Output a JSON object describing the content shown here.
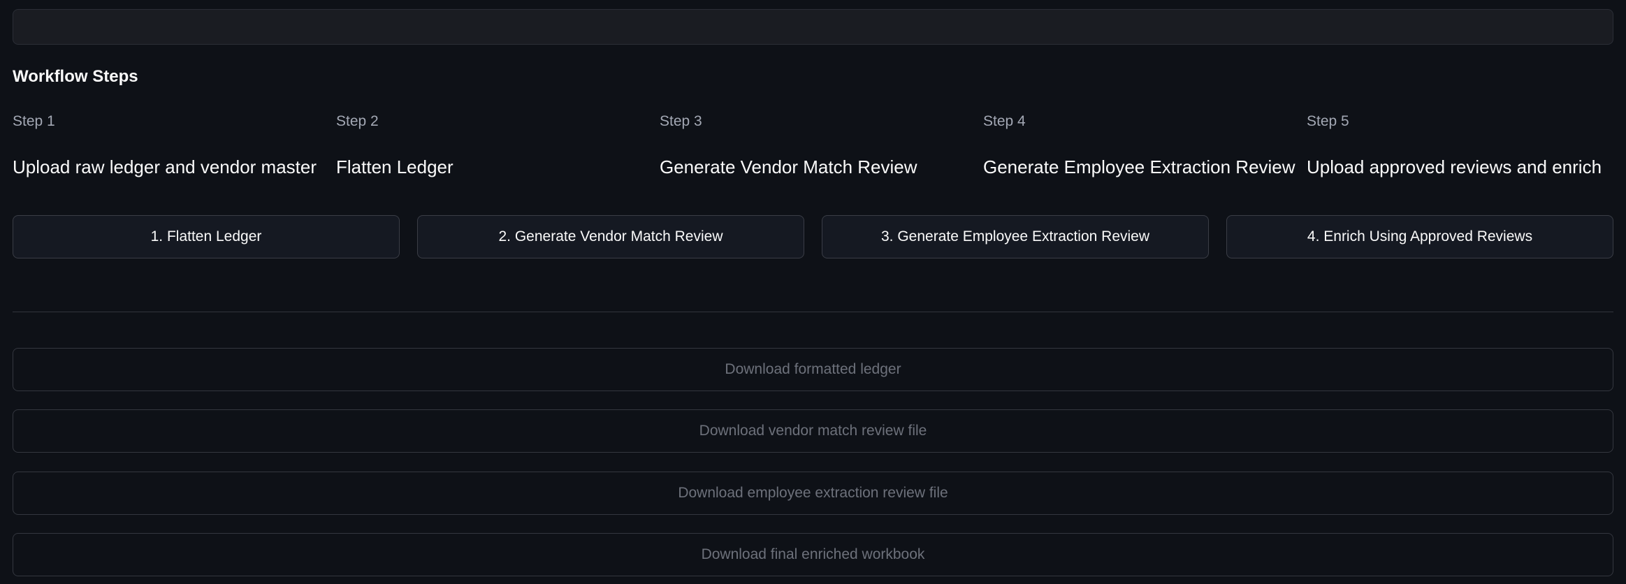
{
  "workflow": {
    "title": "Workflow Steps",
    "steps": [
      {
        "label": "Step 1",
        "description": "Upload raw ledger and vendor master"
      },
      {
        "label": "Step 2",
        "description": "Flatten Ledger"
      },
      {
        "label": "Step 3",
        "description": "Generate Vendor Match Review"
      },
      {
        "label": "Step 4",
        "description": "Generate Employee Extraction Review"
      },
      {
        "label": "Step 5",
        "description": "Upload approved reviews and enrich"
      }
    ]
  },
  "actions": [
    {
      "label": "1. Flatten Ledger"
    },
    {
      "label": "2. Generate Vendor Match Review"
    },
    {
      "label": "3. Generate Employee Extraction Review"
    },
    {
      "label": "4. Enrich Using Approved Reviews"
    }
  ],
  "downloads": [
    {
      "label": "Download formatted ledger",
      "state": "disabled"
    },
    {
      "label": "Download vendor match review file",
      "state": "disabled"
    },
    {
      "label": "Download employee extraction review file",
      "state": "disabled"
    },
    {
      "label": "Download final enriched workbook",
      "state": "disabled"
    }
  ],
  "colors": {
    "background": "#0e1117",
    "text": "#fafafa",
    "muted_text": "#a3a8b4",
    "disabled_text": "#6d717b",
    "border": "#3a3d46"
  }
}
